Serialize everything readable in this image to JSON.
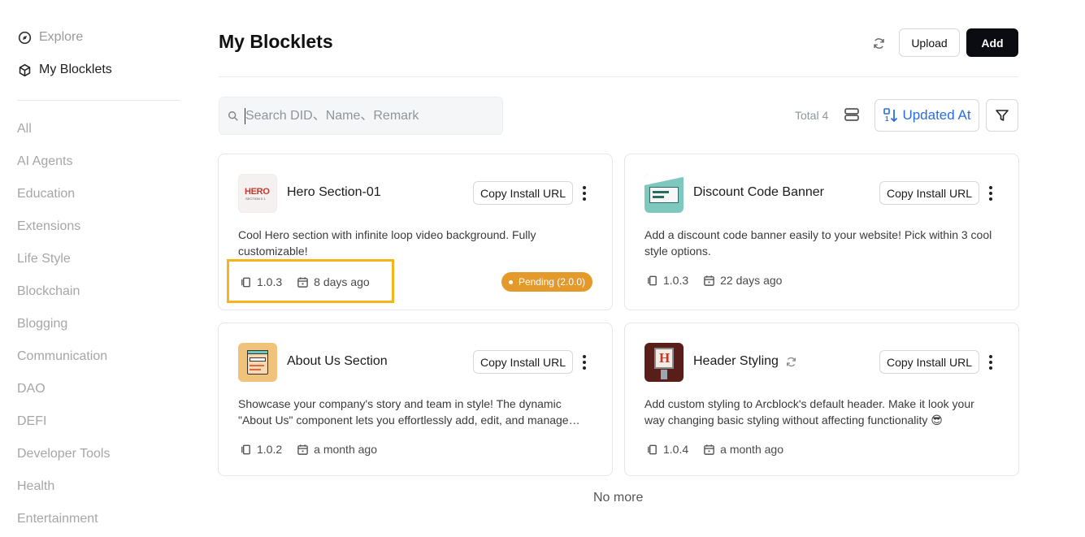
{
  "sidebar": {
    "explore_label": "Explore",
    "my_blocklets_label": "My Blocklets",
    "categories": [
      "All",
      "AI Agents",
      "Education",
      "Extensions",
      "Life Style",
      "Blockchain",
      "Blogging",
      "Communication",
      "DAO",
      "DEFI",
      "Developer Tools",
      "Health",
      "Entertainment"
    ]
  },
  "header": {
    "title": "My Blocklets",
    "upload_label": "Upload",
    "add_label": "Add"
  },
  "toolbar": {
    "search_placeholder": "Search DID、Name、Remark",
    "total_text": "Total 4",
    "sort_label": "Updated At"
  },
  "cards": [
    {
      "name": "Hero Section-01",
      "copy_label": "Copy Install URL",
      "description": "Cool Hero section with infinite loop video background. Fully customizable!",
      "version": "1.0.3",
      "updated": "8 days ago",
      "badge": "Pending (2.0.0)",
      "logo_text_1": "HERO",
      "logo_text_2": "SECTION 0 1"
    },
    {
      "name": "Discount Code Banner",
      "copy_label": "Copy Install URL",
      "description": "Add a discount code banner easily to your website! Pick within 3 cool style options.",
      "version": "1.0.3",
      "updated": "22 days ago"
    },
    {
      "name": "About Us Section",
      "copy_label": "Copy Install URL",
      "description": "Showcase your company's story and team in style! The dynamic \"About Us\" component lets you effortlessly add, edit, and manage…",
      "version": "1.0.2",
      "updated": "a month ago"
    },
    {
      "name": "Header Styling",
      "copy_label": "Copy Install URL",
      "description": "Add custom styling to Arcblock's default header. Make it look your way changing basic styling without affecting functionality 😎",
      "version": "1.0.4",
      "updated": "a month ago",
      "logo_text": "H"
    }
  ],
  "footer": {
    "no_more": "No more"
  },
  "colors": {
    "accent_blue": "#2b6de0",
    "badge_orange": "#e49a2a",
    "highlight_yellow": "#f4b41a",
    "add_button": "#0b0b12"
  }
}
